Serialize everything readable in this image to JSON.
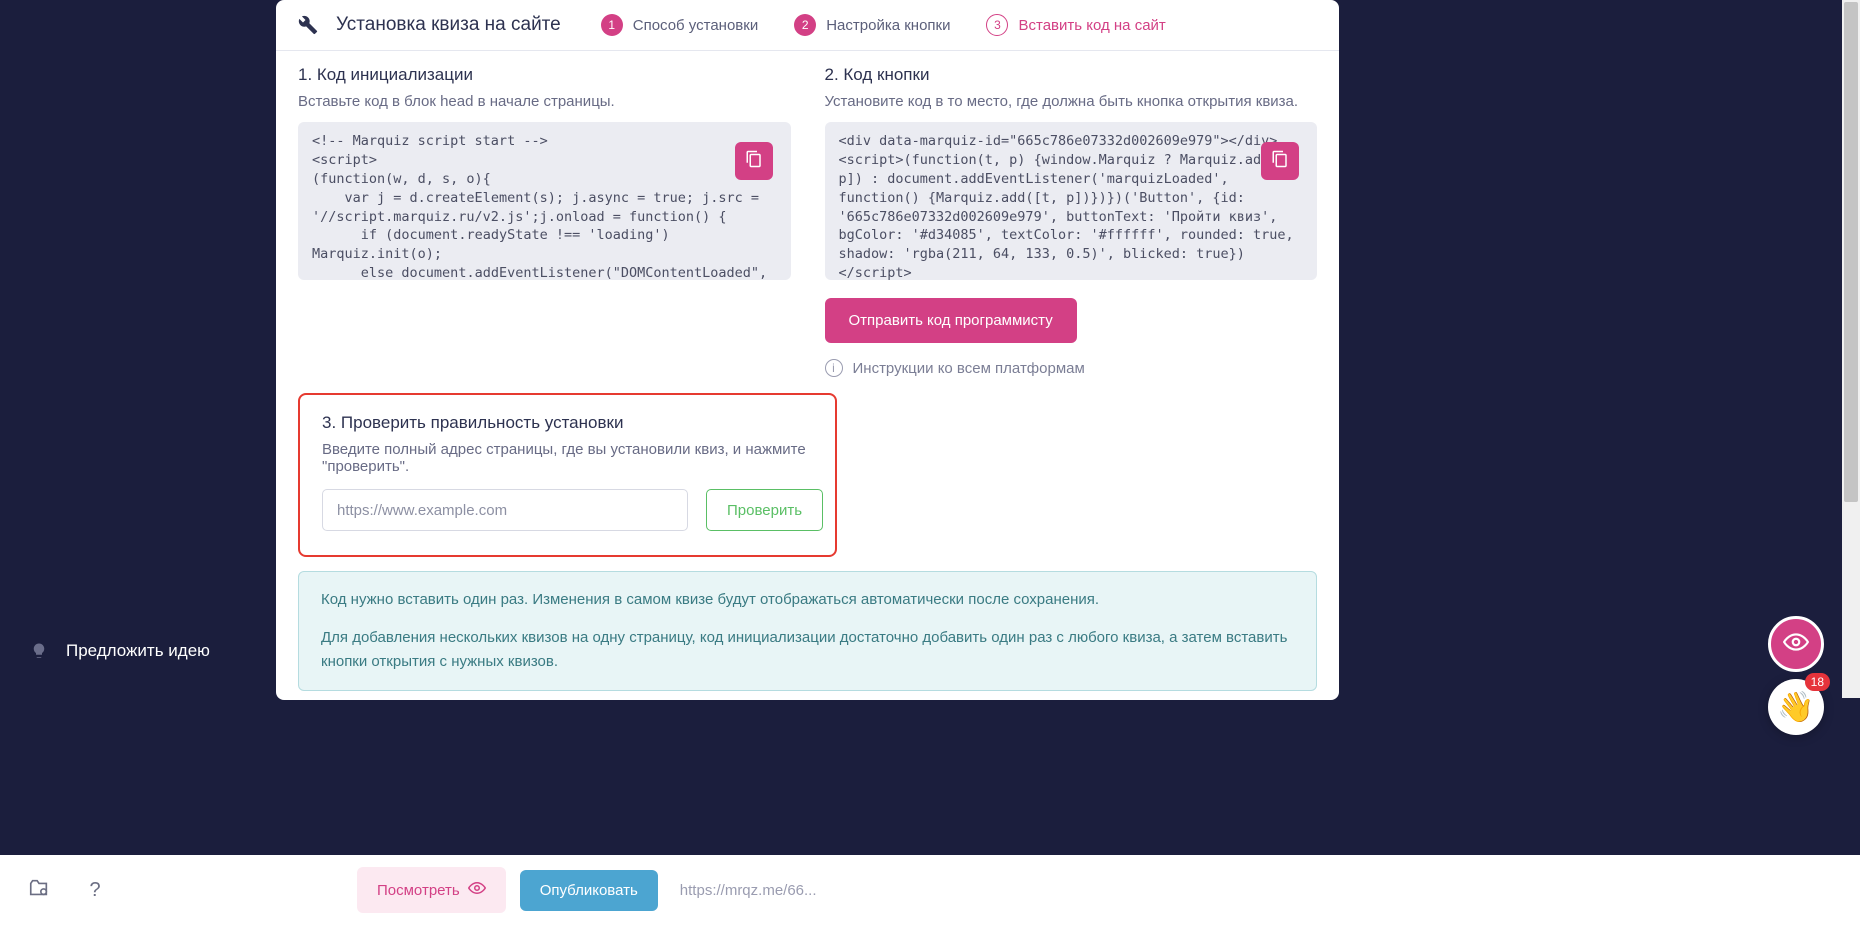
{
  "sidebar": {
    "suggest": "Предложить идею"
  },
  "header": {
    "title": "Установка квиза на сайте",
    "steps": [
      {
        "num": "1",
        "label": "Способ установки"
      },
      {
        "num": "2",
        "label": "Настройка кнопки"
      },
      {
        "num": "3",
        "label": "Вставить код на сайт"
      }
    ]
  },
  "section1": {
    "title": "1. Код инициализации",
    "desc": "Вставьте код в блок head в начале страницы.",
    "code": "<!-- Marquiz script start -->\n<script>\n(function(w, d, s, o){\n    var j = d.createElement(s); j.async = true; j.src = '//script.marquiz.ru/v2.js';j.onload = function() {\n      if (document.readyState !== 'loading') Marquiz.init(o);\n      else document.addEventListener(\"DOMContentLoaded\", function() {\n        Marquiz.init(o);"
  },
  "section2": {
    "title": "2. Код кнопки",
    "desc": "Установите код в то место, где должна быть кнопка открытия квиза.",
    "code": "<div data-marquiz-id=\"665c786e07332d002609e979\"></div>\n<script>(function(t, p) {window.Marquiz ? Marquiz.add([t, p]) : document.addEventListener('marquizLoaded', function() {Marquiz.add([t, p])})})('Button', {id: '665c786e07332d002609e979', buttonText: 'Пройти квиз', bgColor: '#d34085', textColor: '#ffffff', rounded: true, shadow: 'rgba(211, 64, 133, 0.5)', blicked: true})</script>",
    "sendButton": "Отправить код программисту",
    "instructions": "Инструкции ко всем платформам"
  },
  "section3": {
    "title": "3. Проверить правильность установки",
    "desc": "Введите полный адрес страницы, где вы установили квиз, и нажмите \"проверить\".",
    "placeholder": "https://www.example.com",
    "buttonLabel": "Проверить"
  },
  "note": {
    "p1": "Код нужно вставить один раз. Изменения в самом квизе будут отображаться автоматически после сохранения.",
    "p2": "Для добавления нескольких квизов на одну страницу, код инициализации достаточно добавить один раз с любого квиза, а затем вставить кнопки открытия с нужных квизов."
  },
  "bottom": {
    "preview": "Посмотреть",
    "publish": "Опубликовать",
    "url": "https://mrqz.me/66...",
    "help": "?"
  },
  "fab": {
    "badge": "18",
    "wave": "👋"
  }
}
